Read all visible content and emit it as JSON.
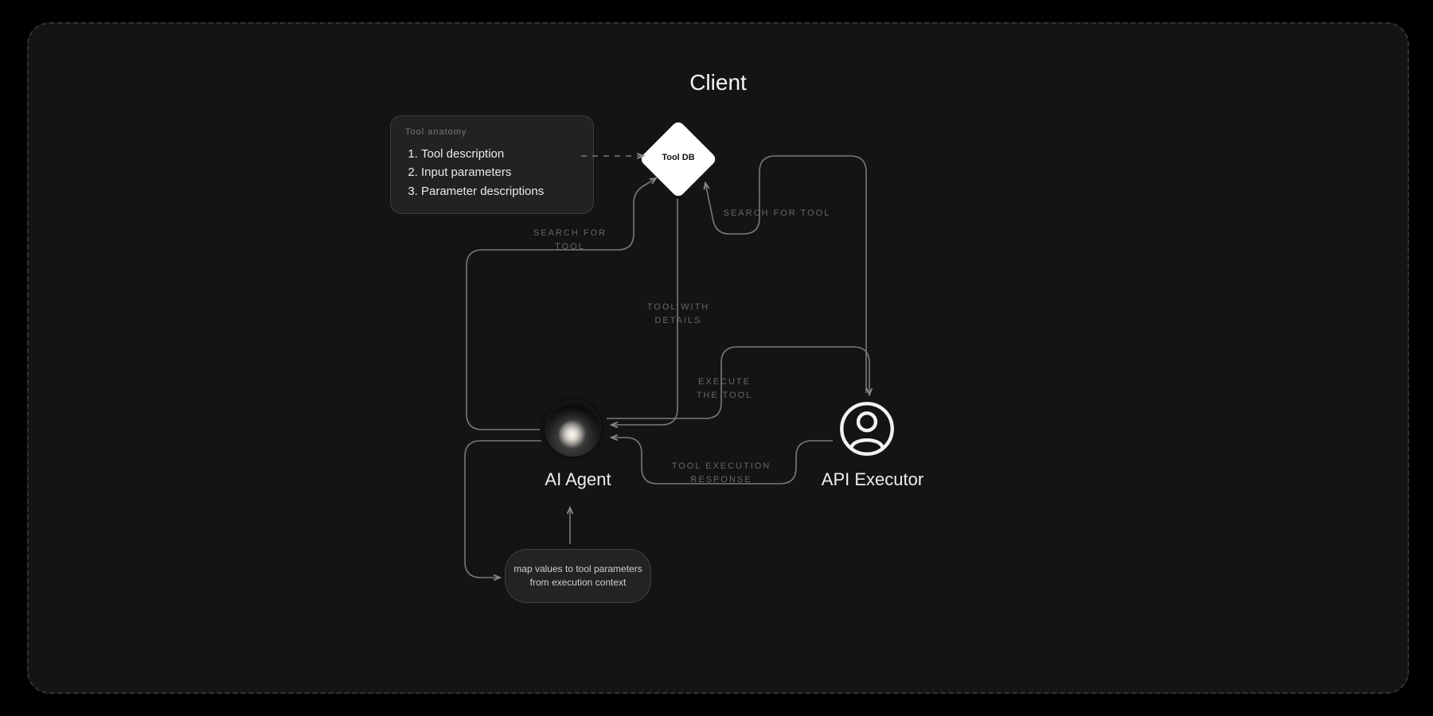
{
  "title": "Client",
  "tool_anatomy": {
    "heading": "Tool anatomy",
    "items": [
      "Tool description",
      "Input parameters",
      "Parameter descriptions"
    ]
  },
  "nodes": {
    "tool_db": {
      "label": "Tool DB"
    },
    "ai_agent": {
      "label": "AI Agent"
    },
    "api_executor": {
      "label": "API Executor"
    },
    "map_values": {
      "label": "map values to tool parameters from execution context"
    }
  },
  "edges": {
    "search_left": "SEARCH FOR\nTOOL",
    "search_right": "SEARCH FOR TOOL",
    "tool_with_details": "TOOL WITH\nDETAILS",
    "execute_the_tool": "EXECUTE\nTHE TOOL",
    "tool_execution_response": "TOOL EXECUTION\nRESPONSE"
  }
}
